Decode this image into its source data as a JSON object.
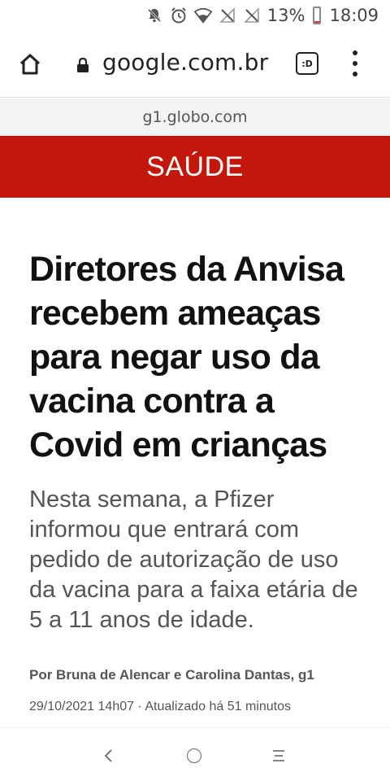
{
  "status_bar": {
    "battery_percent": "13%",
    "battery_level": 0.13,
    "time": "18:09",
    "icons": [
      "mute-notifications-icon",
      "alarm-icon",
      "wifi-icon",
      "no-signal-icon",
      "no-signal-icon"
    ]
  },
  "browser": {
    "url": "google.com.br",
    "tab_label": ":D"
  },
  "domain": "g1.globo.com",
  "section": {
    "label": "SAÚDE",
    "color": "#c4170c"
  },
  "article": {
    "headline": "Diretores da Anvisa recebem ameaças para negar uso da vacina contra a Covid em crianças",
    "subheadline": "Nesta semana, a Pfizer informou que entrará com pedido de autorização de uso da vacina para a faixa etária de 5 a 11 anos de idade.",
    "byline": "Por Bruna de Alencar e Carolina Dantas, g1",
    "dateline": "29/10/2021 14h07 · Atualizado há 51 minutos"
  }
}
